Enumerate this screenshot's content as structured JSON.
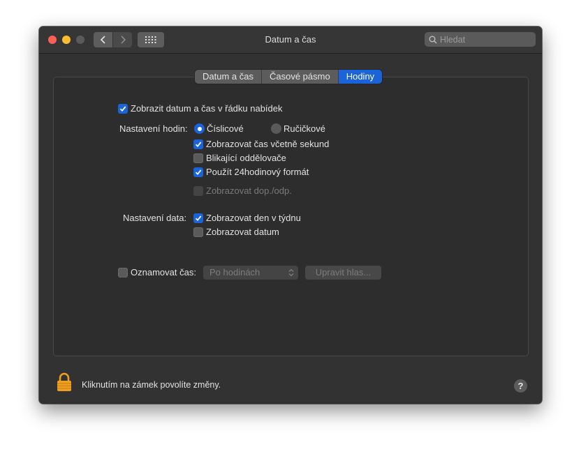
{
  "window": {
    "title": "Datum a čas",
    "search_placeholder": "Hledat"
  },
  "tabs": [
    {
      "label": "Datum a čas",
      "selected": false
    },
    {
      "label": "Časové pásmo",
      "selected": false
    },
    {
      "label": "Hodiny",
      "selected": true
    }
  ],
  "clock": {
    "show_in_menubar": {
      "label": "Zobrazit datum a čas v řádku nabídek",
      "checked": true
    },
    "time_options_label": "Nastavení hodin:",
    "radio_digital": {
      "label": "Číslicové",
      "selected": true
    },
    "radio_analog": {
      "label": "Ručičkové",
      "selected": false
    },
    "show_seconds": {
      "label": "Zobrazovat čas včetně sekund",
      "checked": true
    },
    "flash_separators": {
      "label": "Blikající oddělovače",
      "checked": false
    },
    "use_24h": {
      "label": "Použít 24hodinový formát",
      "checked": true
    },
    "show_ampm": {
      "label": "Zobrazovat dop./odp.",
      "checked": false,
      "enabled": false
    },
    "date_options_label": "Nastavení data:",
    "show_day_of_week": {
      "label": "Zobrazovat den v týdnu",
      "checked": true
    },
    "show_date": {
      "label": "Zobrazovat datum",
      "checked": false
    },
    "announce_time": {
      "label": "Oznamovat čas:",
      "checked": false
    },
    "announce_interval": "Po hodinách",
    "customize_voice": "Upravit hlas..."
  },
  "footer": {
    "lock_text": "Kliknutím na zámek povolíte změny.",
    "help": "?"
  },
  "colors": {
    "accent": "#1a63d8",
    "window_bg": "#323232",
    "lock": "#f0a020"
  }
}
